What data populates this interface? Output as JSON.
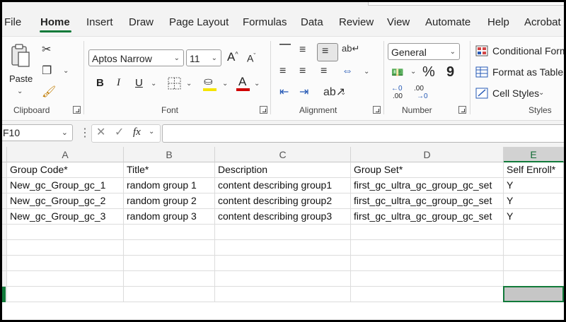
{
  "tabs": [
    "File",
    "Home",
    "Insert",
    "Draw",
    "Page Layout",
    "Formulas",
    "Data",
    "Review",
    "View",
    "Automate",
    "Help",
    "Acrobat"
  ],
  "clipboard": {
    "paste_label": "Paste",
    "group_label": "Clipboard"
  },
  "font": {
    "name": "Aptos Narrow",
    "size": "11",
    "group_label": "Font",
    "grow": "A",
    "shrink": "A",
    "bold": "B",
    "italic": "I",
    "underline": "U",
    "font_color_letter": "A",
    "highlight_color": "#f5e400",
    "font_color": "#d00000"
  },
  "alignment": {
    "group_label": "Alignment"
  },
  "number": {
    "format": "General",
    "group_label": "Number",
    "percent": "%",
    "comma": "9",
    "inc_decimal": ".00",
    "dec_decimal": ".00"
  },
  "styles": {
    "conditional": "Conditional Form",
    "format_table": "Format as Table",
    "cell_styles": "Cell Styles",
    "group_label": "Styles"
  },
  "formula_bar": {
    "name_box": "F10",
    "fx": "fx",
    "value": ""
  },
  "sheet": {
    "columns": [
      "A",
      "B",
      "C",
      "D",
      "E"
    ],
    "selected_column": "E",
    "rows": [
      [
        "Group Code*",
        "Title*",
        "Description",
        "Group Set*",
        "Self Enroll*"
      ],
      [
        "New_gc_Group_gc_1",
        "random group 1",
        "content describing group1",
        "first_gc_ultra_gc_group_gc_set",
        "Y"
      ],
      [
        "New_gc_Group_gc_2",
        "random group 2",
        "content describing group2",
        "first_gc_ultra_gc_group_gc_set",
        "Y"
      ],
      [
        "New_gc_Group_gc_3",
        "random group 3",
        "content describing group3",
        "first_gc_ultra_gc_group_gc_set",
        "Y"
      ],
      [
        "",
        "",
        "",
        "",
        ""
      ],
      [
        "",
        "",
        "",
        "",
        ""
      ],
      [
        "",
        "",
        "",
        "",
        ""
      ],
      [
        "",
        "",
        "",
        "",
        ""
      ],
      [
        "",
        "",
        "",
        "",
        ""
      ]
    ]
  },
  "colors": {
    "accent": "#117a3a"
  }
}
